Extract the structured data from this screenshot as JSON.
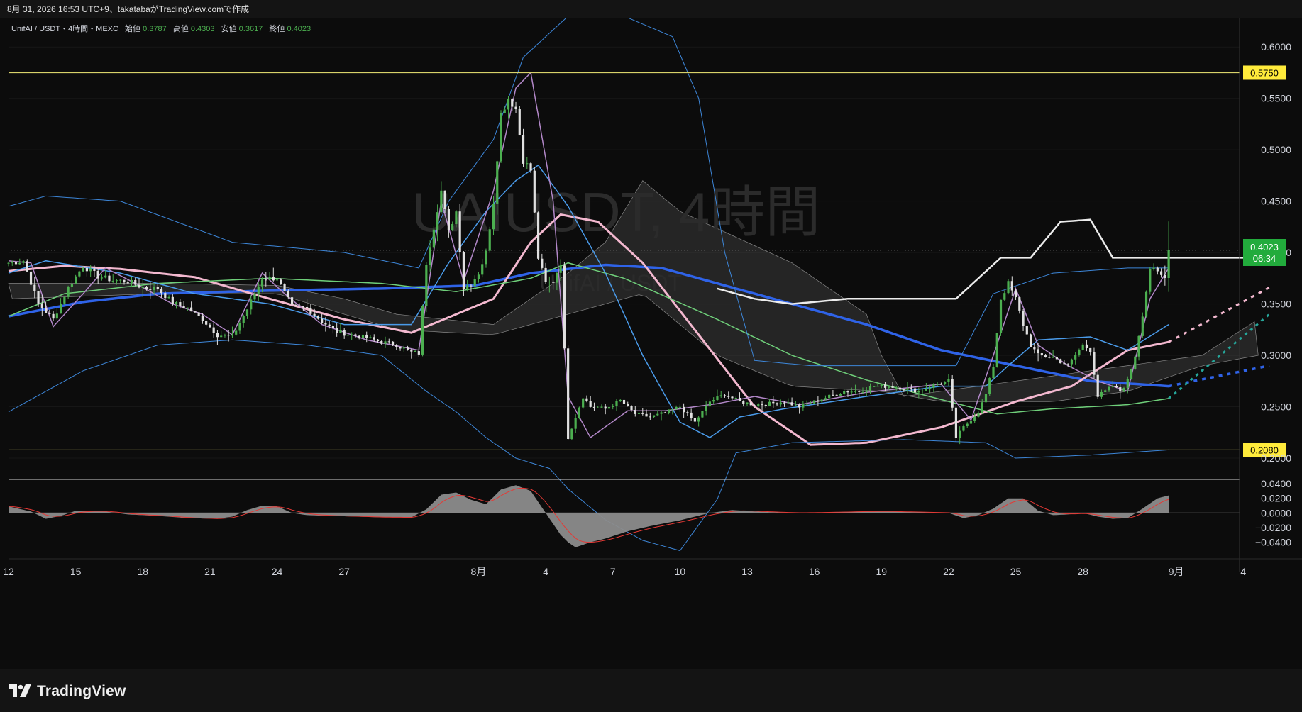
{
  "header": {
    "caption": "8月 31, 2026 16:53 UTC+9、takatabaがTradingView.comで作成"
  },
  "legend": {
    "symbol": "UnifAI / USDT・4時間・MEXC",
    "open_label": "始値",
    "open_value": "0.3787",
    "high_label": "高値",
    "high_value": "0.4303",
    "low_label": "安値",
    "low_value": "0.3617",
    "close_label": "終値",
    "close_value": "0.4023"
  },
  "watermark": {
    "title": "UAIUSDT, 4時間",
    "subtitle": "UnifAI / USDT"
  },
  "price_tag": {
    "value": "0.4023",
    "countdown": "06:34"
  },
  "levels": [
    {
      "value": 0.575,
      "label": "0.5750"
    },
    {
      "value": 0.208,
      "label": "0.2080"
    }
  ],
  "footer": {
    "brand": "TradingView"
  },
  "colors": {
    "up": "#4caf50",
    "down": "#e0e0e0",
    "level_line": "#d8d26a",
    "level_tag": "#ffeb3b",
    "price_tag": "#22ab3c",
    "ma_blue": "#2f63e8",
    "ma_pink": "#f3b8cf",
    "ma_green": "#6fcf7a",
    "ichimoku_white": "#ececec",
    "bollinger": "#3d86d8",
    "cloud": "#555555",
    "macd_hist": "#8c8c8c",
    "macd_signal": "#e53935"
  },
  "chart_data": [
    {
      "type": "candlestick",
      "ylim": [
        0.18,
        0.625
      ],
      "ytick_labels": [
        "0.6000",
        "0.5500",
        "0.5000",
        "0.4500",
        "0.4000",
        "0.3500",
        "0.3000",
        "0.2500",
        "0.2000"
      ],
      "yticks": [
        0.6,
        0.55,
        0.5,
        0.45,
        0.4,
        0.35,
        0.3,
        0.25,
        0.2
      ],
      "x_label_positions": [
        0,
        18,
        36,
        54,
        72,
        90,
        119,
        137,
        155,
        173,
        191,
        209,
        227,
        245,
        263,
        281,
        298,
        316,
        344,
        362
      ],
      "xtick_labels": [
        "12",
        "15",
        "18",
        "21",
        "24",
        "27",
        "8月",
        "4",
        "7",
        "10",
        "13",
        "16",
        "19",
        "22",
        "25",
        "28",
        "9月",
        "4"
      ],
      "x_index_range": [
        0,
        330
      ],
      "last": {
        "open": 0.3787,
        "high": 0.4303,
        "low": 0.3617,
        "close": 0.4023
      },
      "anchors": [
        [
          0,
          0.39
        ],
        [
          4,
          0.392
        ],
        [
          8,
          0.35
        ],
        [
          12,
          0.335
        ],
        [
          16,
          0.366
        ],
        [
          20,
          0.387
        ],
        [
          24,
          0.377
        ],
        [
          28,
          0.373
        ],
        [
          32,
          0.372
        ],
        [
          36,
          0.366
        ],
        [
          40,
          0.365
        ],
        [
          44,
          0.351
        ],
        [
          48,
          0.346
        ],
        [
          52,
          0.335
        ],
        [
          56,
          0.32
        ],
        [
          60,
          0.318
        ],
        [
          64,
          0.345
        ],
        [
          68,
          0.375
        ],
        [
          72,
          0.375
        ],
        [
          76,
          0.347
        ],
        [
          80,
          0.346
        ],
        [
          84,
          0.333
        ],
        [
          88,
          0.323
        ],
        [
          92,
          0.32
        ],
        [
          96,
          0.317
        ],
        [
          100,
          0.313
        ],
        [
          104,
          0.31
        ],
        [
          108,
          0.303
        ],
        [
          110,
          0.302
        ],
        [
          112,
          0.39
        ],
        [
          116,
          0.46
        ],
        [
          118,
          0.42
        ],
        [
          120,
          0.44
        ],
        [
          122,
          0.366
        ],
        [
          124,
          0.37
        ],
        [
          126,
          0.38
        ],
        [
          128,
          0.4
        ],
        [
          130,
          0.45
        ],
        [
          132,
          0.535
        ],
        [
          134,
          0.55
        ],
        [
          136,
          0.54
        ],
        [
          138,
          0.49
        ],
        [
          140,
          0.48
        ],
        [
          142,
          0.395
        ],
        [
          144,
          0.37
        ],
        [
          146,
          0.372
        ],
        [
          148,
          0.39
        ],
        [
          150,
          0.22
        ],
        [
          152,
          0.24
        ],
        [
          154,
          0.26
        ],
        [
          156,
          0.25
        ],
        [
          160,
          0.248
        ],
        [
          164,
          0.256
        ],
        [
          168,
          0.243
        ],
        [
          172,
          0.24
        ],
        [
          176,
          0.244
        ],
        [
          180,
          0.25
        ],
        [
          184,
          0.235
        ],
        [
          188,
          0.255
        ],
        [
          192,
          0.262
        ],
        [
          196,
          0.255
        ],
        [
          200,
          0.252
        ],
        [
          204,
          0.253
        ],
        [
          208,
          0.255
        ],
        [
          212,
          0.25
        ],
        [
          216,
          0.255
        ],
        [
          220,
          0.26
        ],
        [
          224,
          0.265
        ],
        [
          228,
          0.265
        ],
        [
          232,
          0.27
        ],
        [
          236,
          0.27
        ],
        [
          240,
          0.268
        ],
        [
          244,
          0.265
        ],
        [
          248,
          0.271
        ],
        [
          252,
          0.275
        ],
        [
          254,
          0.22
        ],
        [
          256,
          0.23
        ],
        [
          260,
          0.245
        ],
        [
          262,
          0.262
        ],
        [
          264,
          0.29
        ],
        [
          266,
          0.355
        ],
        [
          268,
          0.37
        ],
        [
          270,
          0.355
        ],
        [
          272,
          0.33
        ],
        [
          274,
          0.31
        ],
        [
          276,
          0.3
        ],
        [
          280,
          0.298
        ],
        [
          284,
          0.29
        ],
        [
          288,
          0.31
        ],
        [
          290,
          0.305
        ],
        [
          292,
          0.26
        ],
        [
          294,
          0.265
        ],
        [
          296,
          0.27
        ],
        [
          298,
          0.265
        ],
        [
          300,
          0.275
        ],
        [
          302,
          0.3
        ],
        [
          304,
          0.34
        ],
        [
          306,
          0.385
        ],
        [
          308,
          0.38
        ],
        [
          310,
          0.375
        ],
        [
          311,
          0.4023
        ]
      ]
    },
    {
      "type": "area",
      "name": "MACD",
      "ylim": [
        -0.053,
        0.043
      ],
      "yticks": [
        0.04,
        0.02,
        0.0,
        -0.02,
        -0.04
      ],
      "ytick_labels": [
        "0.0400",
        "0.0200",
        "0.0000",
        "−0.0200",
        "−0.0400"
      ],
      "anchors": [
        [
          0,
          0.009
        ],
        [
          6,
          0.002
        ],
        [
          10,
          -0.008
        ],
        [
          14,
          -0.004
        ],
        [
          18,
          0.003
        ],
        [
          22,
          0.003
        ],
        [
          26,
          0.002
        ],
        [
          32,
          -0.002
        ],
        [
          40,
          -0.004
        ],
        [
          48,
          -0.007
        ],
        [
          56,
          -0.008
        ],
        [
          60,
          -0.005
        ],
        [
          64,
          0.004
        ],
        [
          68,
          0.01
        ],
        [
          72,
          0.009
        ],
        [
          76,
          0.0
        ],
        [
          80,
          -0.003
        ],
        [
          86,
          -0.004
        ],
        [
          94,
          -0.005
        ],
        [
          100,
          -0.006
        ],
        [
          108,
          -0.006
        ],
        [
          112,
          0.005
        ],
        [
          116,
          0.025
        ],
        [
          120,
          0.028
        ],
        [
          124,
          0.018
        ],
        [
          128,
          0.012
        ],
        [
          132,
          0.032
        ],
        [
          136,
          0.038
        ],
        [
          140,
          0.03
        ],
        [
          144,
          0.0
        ],
        [
          148,
          -0.03
        ],
        [
          150,
          -0.04
        ],
        [
          152,
          -0.047
        ],
        [
          156,
          -0.04
        ],
        [
          160,
          -0.035
        ],
        [
          166,
          -0.025
        ],
        [
          172,
          -0.018
        ],
        [
          180,
          -0.01
        ],
        [
          188,
          0.0
        ],
        [
          194,
          0.004
        ],
        [
          200,
          0.002
        ],
        [
          210,
          0.0
        ],
        [
          220,
          0.001
        ],
        [
          228,
          0.002
        ],
        [
          236,
          0.002
        ],
        [
          244,
          0.001
        ],
        [
          252,
          0.0
        ],
        [
          256,
          -0.007
        ],
        [
          260,
          -0.003
        ],
        [
          264,
          0.006
        ],
        [
          268,
          0.02
        ],
        [
          272,
          0.02
        ],
        [
          276,
          0.003
        ],
        [
          280,
          -0.003
        ],
        [
          284,
          -0.002
        ],
        [
          288,
          0.0
        ],
        [
          292,
          -0.005
        ],
        [
          296,
          -0.008
        ],
        [
          300,
          -0.007
        ],
        [
          304,
          0.006
        ],
        [
          308,
          0.02
        ],
        [
          311,
          0.024
        ]
      ]
    }
  ]
}
